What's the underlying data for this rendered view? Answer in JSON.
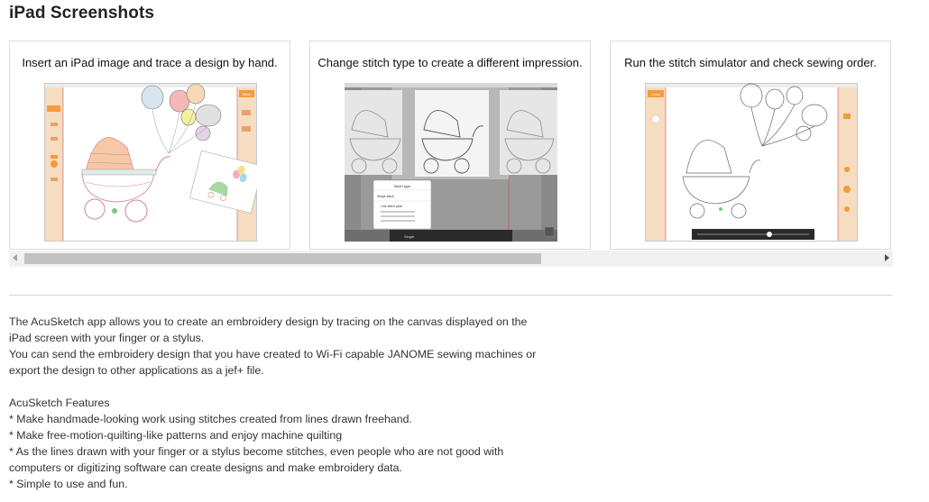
{
  "section": {
    "title": "iPad Screenshots"
  },
  "screenshots": [
    {
      "caption": "Insert an iPad image and trace a design by hand.",
      "stitch_button": "Stitch"
    },
    {
      "caption": "Change stitch type to create a different impression.",
      "popup_title": "Stitch type",
      "popup_option1": "Single stitch",
      "popup_option2": "Line stitch pack",
      "bottom_label": "Single"
    },
    {
      "caption": "Run the stitch simulator and check sewing order.",
      "close_button": "Close"
    }
  ],
  "description": {
    "paragraph1": [
      "The AcuSketch app allows you to create an embroidery design by tracing on the canvas displayed on the",
      "iPad screen with your finger or a stylus.",
      "You can send the embroidery design that you have created to Wi-Fi capable JANOME sewing machines or",
      "export the design to other applications as a jef+ file."
    ],
    "features_title": "AcuSketch Features",
    "features": [
      "* Make handmade-looking work using stitches created from lines drawn freehand.",
      "* Make free-motion-quilting-like patterns and enjoy machine quilting",
      "* As the lines drawn with your finger or a stylus become stitches, even people who are not good with",
      "computers or digitizing software can create designs and make embroidery data.",
      "* Simple to use and fun."
    ]
  },
  "colors": {
    "accent": "#f39c3a",
    "sidebar": "#f6dcc0",
    "border": "#dcdcdc"
  }
}
